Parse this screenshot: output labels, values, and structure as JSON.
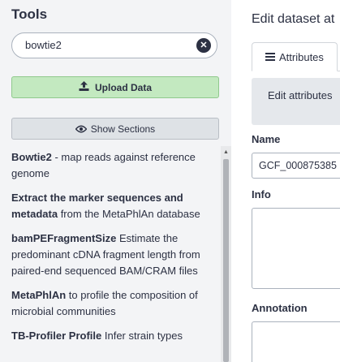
{
  "tools_panel": {
    "heading": "Tools",
    "search": {
      "value": "bowtie2",
      "clear_icon": "close-circle-icon"
    },
    "upload_button": {
      "label": "Upload Data",
      "icon": "upload-icon"
    },
    "sections_button": {
      "label": "Show Sections",
      "icon": "eye-icon"
    },
    "results": [
      {
        "name": "Bowtie2",
        "description": " - map reads against reference genome"
      },
      {
        "name": "Extract the marker sequences and metadata",
        "description": " from the MetaPhlAn database"
      },
      {
        "name": "bamPEFragmentSize",
        "description": " Estimate the predominant cDNA fragment length from paired-end sequenced BAM/CRAM files"
      },
      {
        "name": "MetaPhlAn",
        "description": " to profile the composition of microbial communities"
      },
      {
        "name": "TB-Profiler Profile",
        "description": " Infer strain types"
      }
    ]
  },
  "center": {
    "title": "Edit dataset at",
    "tab_attributes": {
      "label": "Attributes",
      "icon": "bars-icon"
    },
    "alert_text": "Edit attributes",
    "name_label": "Name",
    "name_value": "GCF_000875385",
    "info_label": "Info",
    "annotation_label": "Annotation"
  }
}
